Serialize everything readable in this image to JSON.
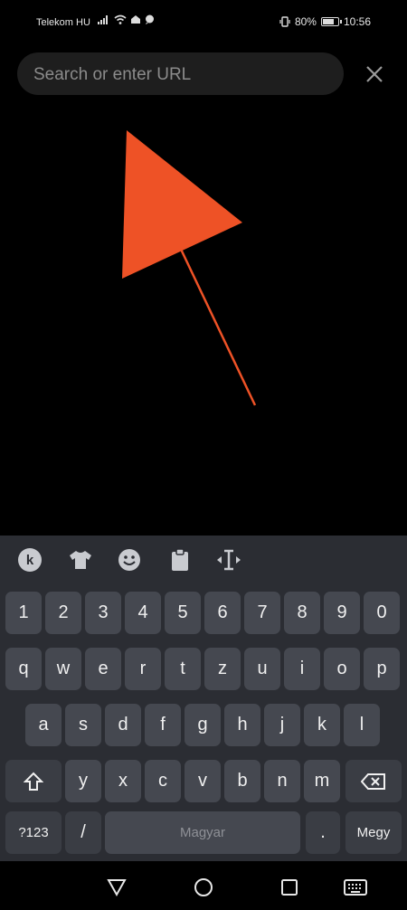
{
  "status_bar": {
    "carrier": "Telekom HU",
    "battery_percent_label": "80%",
    "battery_level": 0.8,
    "time": "10:56"
  },
  "browser": {
    "search_placeholder": "Search or enter URL",
    "close_icon": "close-icon"
  },
  "overlay": {
    "arrow_color": "#ee5226"
  },
  "keyboard": {
    "toolbar_icons": [
      "k-logo-icon",
      "shirt-icon",
      "emoji-icon",
      "clipboard-icon",
      "text-cursor-icon"
    ],
    "number_row": [
      "1",
      "2",
      "3",
      "4",
      "5",
      "6",
      "7",
      "8",
      "9",
      "0"
    ],
    "row1": [
      "q",
      "w",
      "e",
      "r",
      "t",
      "z",
      "u",
      "i",
      "o",
      "p"
    ],
    "row2": [
      "a",
      "s",
      "d",
      "f",
      "g",
      "h",
      "j",
      "k",
      "l"
    ],
    "row3": [
      "y",
      "x",
      "c",
      "v",
      "b",
      "n",
      "m"
    ],
    "symbols_label": "?123",
    "slash_label": "/",
    "space_label": "Magyar",
    "period_label": ".",
    "action_label": "Megy"
  },
  "nav_bar": {
    "icons": [
      "back-icon",
      "home-icon",
      "recents-icon",
      "keyboard-switch-icon"
    ]
  }
}
